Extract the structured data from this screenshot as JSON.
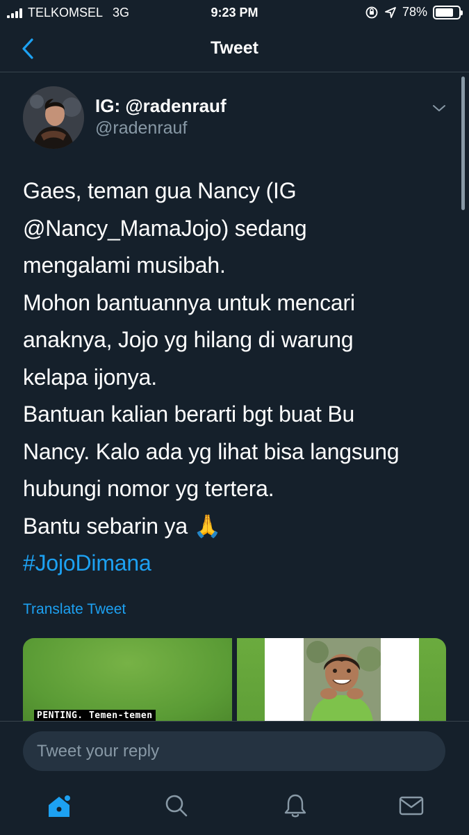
{
  "status_bar": {
    "carrier": "TELKOMSEL",
    "network": "3G",
    "time": "9:23 PM",
    "battery": "78%",
    "battery_level": 0.78
  },
  "nav": {
    "title": "Tweet"
  },
  "tweet": {
    "display_name": "IG: @radenrauf",
    "username": "@radenrauf",
    "lines": [
      "Gaes, teman gua Nancy (IG",
      "@Nancy_MamaJojo) sedang",
      "mengalami musibah.",
      "Mohon bantuannya untuk mencari",
      "anaknya, Jojo yg hilang di warung",
      "kelapa ijonya.",
      "Bantuan kalian berarti bgt buat Bu",
      "Nancy. Kalo ada yg lihat bisa langsung",
      "hubungi nomor yg tertera.",
      "Bantu sebarin ya 🙏"
    ],
    "hashtag": "#JojoDimana",
    "translate_label": "Translate Tweet",
    "media_caption": "PENTING.  Temen-temen"
  },
  "reply": {
    "placeholder": "Tweet your reply"
  },
  "tab_bar": {
    "icons": [
      "home-icon",
      "search-icon",
      "notifications-icon",
      "messages-icon"
    ],
    "active_color": "#1da1f2",
    "inactive_color": "#8899a6"
  }
}
